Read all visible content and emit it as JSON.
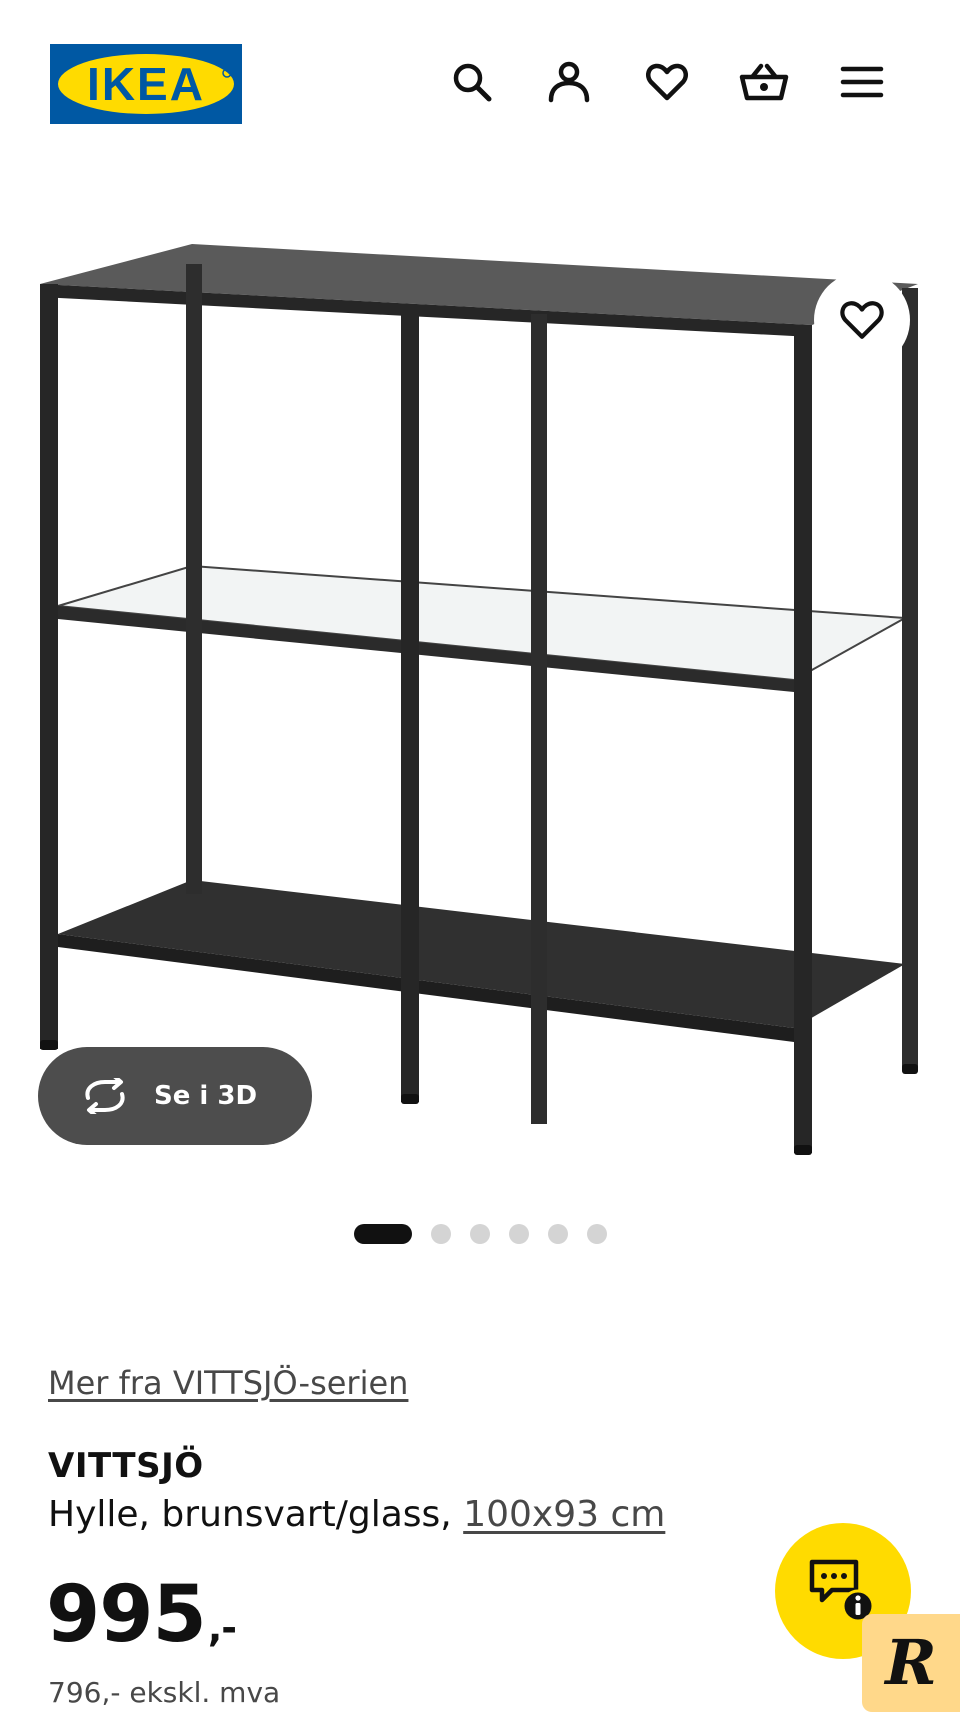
{
  "header": {
    "logo_text": "IKEA",
    "icons": [
      "search-icon",
      "user-icon",
      "heart-icon",
      "basket-icon",
      "menu-icon"
    ]
  },
  "gallery": {
    "view_3d_label": "Se i 3D",
    "image_count": 6,
    "active_index": 0
  },
  "product": {
    "series_link": "Mer fra VITTSJÖ-serien",
    "name": "VITTSJÖ",
    "description": "Hylle, brunsvart/glass,",
    "size": "100x93 cm",
    "price": "995",
    "price_suffix": ",-",
    "price_ex_vat": "796,- ekskl. mva"
  },
  "widgets": {
    "chat_icon": "chat-info-icon",
    "badge_letter": "R"
  },
  "colors": {
    "ikea_blue": "#0058A3",
    "ikea_yellow": "#FFDB00",
    "dark_button": "#4D4D4D",
    "badge": "#FFD88A"
  }
}
